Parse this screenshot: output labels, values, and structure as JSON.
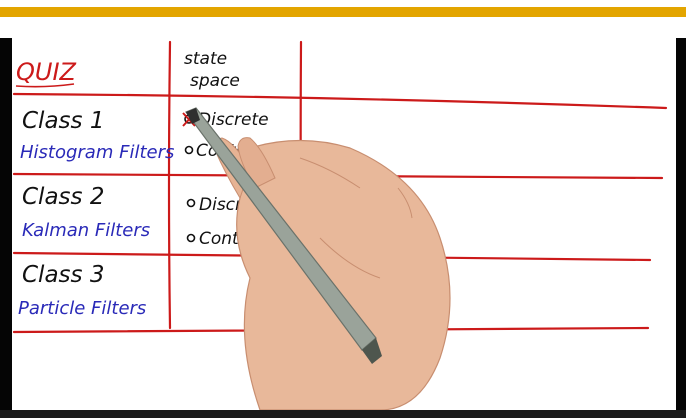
{
  "quiz": {
    "title": "QUIZ",
    "column_header_line1": "state",
    "column_header_line2": "space",
    "rows": [
      {
        "class_label": "Class 1",
        "filter_name": "Histogram Filters",
        "options": [
          "Discrete",
          "Continuous"
        ],
        "selected": "Discrete"
      },
      {
        "class_label": "Class 2",
        "filter_name": "Kalman Filters",
        "options": [
          "Discrete",
          "Continuous"
        ]
      },
      {
        "class_label": "Class 3",
        "filter_name": "Particle Filters",
        "options": []
      }
    ]
  },
  "colors": {
    "accent_bar": "#e3a500",
    "ink_red": "#cc1a1a",
    "ink_blue": "#2a2ab8",
    "ink_black": "#111111",
    "frame_black": "#050505"
  }
}
